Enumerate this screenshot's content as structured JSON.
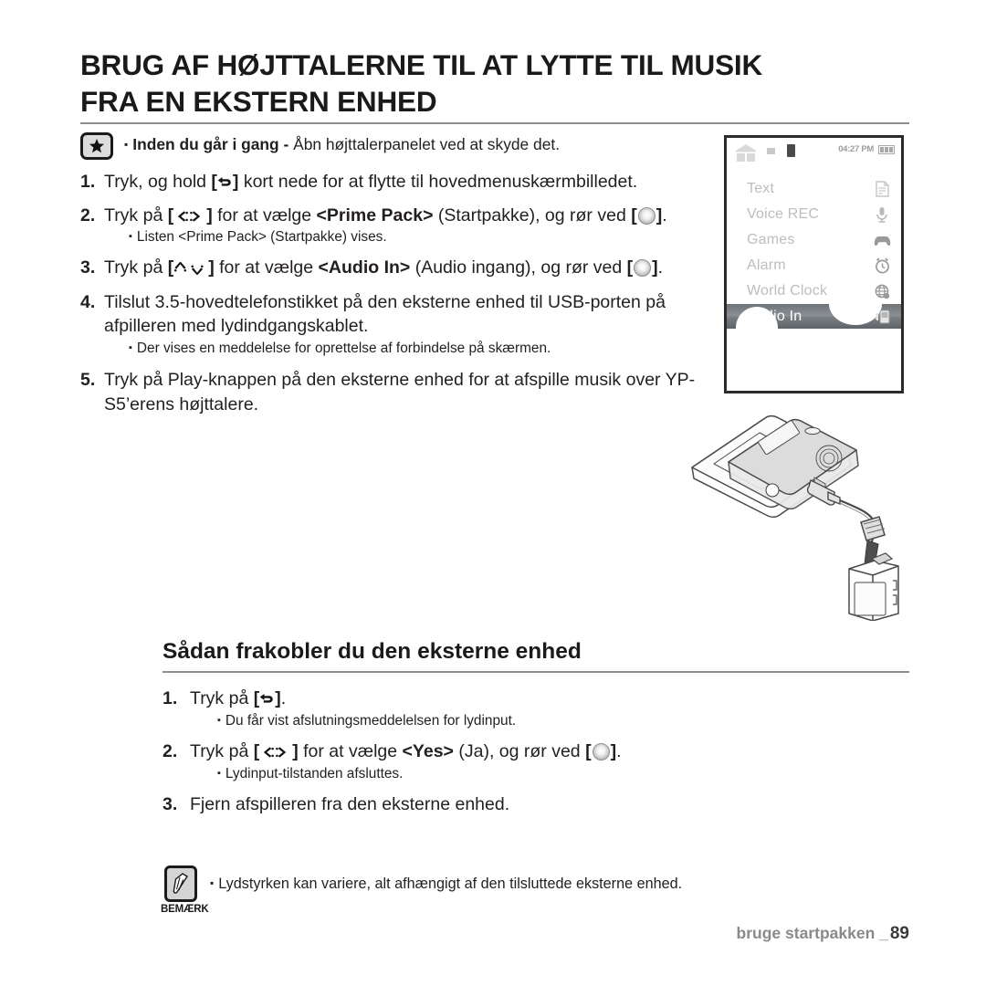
{
  "page": {
    "title_line1": "BRUG AF HØJTTALERNE TIL AT LYTTE TIL MUSIK",
    "title_line2": "FRA EN EKSTERN ENHED",
    "intro_bold": "Inden du går i gang -",
    "intro_rest": " Åbn højttalerpanelet ved at skyde det."
  },
  "steps": [
    {
      "num": "1.",
      "pre": "Tryk, og hold ",
      "key": "back",
      "post": " kort nede for at flytte til hovedmenuskærmbilledet.",
      "sub": null
    },
    {
      "num": "2.",
      "pre": "Tryk på ",
      "key": "left-right",
      "mid": " for at vælge ",
      "bold": "<Prime Pack>",
      "after_bold": " (Startpakke), og rør ved ",
      "key2": "touch",
      "post": ".",
      "sub": "Listen <Prime Pack> (Startpakke) vises."
    },
    {
      "num": "3.",
      "pre": "Tryk på ",
      "key": "up-down",
      "mid": " for at vælge ",
      "bold": "<Audio In>",
      "after_bold": " (Audio ingang), og rør ved ",
      "key2": "touch",
      "post": ".",
      "sub": null
    },
    {
      "num": "4.",
      "pre": "Tilslut 3.5-hovedtelefonstikket på den eksterne enhed til USB-porten på afpilleren med lydindgangskablet.",
      "key": null,
      "post": "",
      "sub": "Der vises en meddelelse for oprettelse af forbindelse på skærmen."
    },
    {
      "num": "5.",
      "pre": "Tryk på Play-knappen på den eksterne enhed for at afspille musik over YP-S5’erens højttalere.",
      "key": null,
      "post": "",
      "sub": null
    }
  ],
  "device_screen": {
    "time": "04:27 PM",
    "menu_items": [
      {
        "label": "Text",
        "icon": "document-icon"
      },
      {
        "label": "Voice REC",
        "icon": "microphone-icon"
      },
      {
        "label": "Games",
        "icon": "gamepad-icon"
      },
      {
        "label": "Alarm",
        "icon": "alarm-clock-icon"
      },
      {
        "label": "World Clock",
        "icon": "globe-icon"
      }
    ],
    "selected_item": {
      "label": "Audio In",
      "icon": "audio-in-icon"
    }
  },
  "section2": {
    "heading": "Sådan frakobler du den eksterne enhed",
    "steps": [
      {
        "num": "1.",
        "pre": "Tryk på ",
        "key": "back",
        "post": ".",
        "sub": "Du får vist afslutningsmeddelelsen for lydinput."
      },
      {
        "num": "2.",
        "pre": "Tryk på ",
        "key": "left-right",
        "mid": " for at vælge ",
        "bold": "<Yes>",
        "after_bold": " (Ja), og rør ved ",
        "key2": "touch",
        "post": ".",
        "sub": "Lydinput-tilstanden afsluttes."
      },
      {
        "num": "3.",
        "pre": "Fjern afspilleren fra den eksterne enhed.",
        "key": null,
        "post": "",
        "sub": null
      }
    ]
  },
  "note": {
    "caption": "BEMÆRK",
    "text": "Lydstyrken kan variere, alt afhængigt af den tilsluttede eksterne enhed."
  },
  "footer": {
    "label": "bruge startpakken _",
    "page_number": "89"
  },
  "colors": {
    "text": "#231f20",
    "rule": "#8d8d8d",
    "muted": "#bdbdbd",
    "footer": "#8a8a8a"
  }
}
